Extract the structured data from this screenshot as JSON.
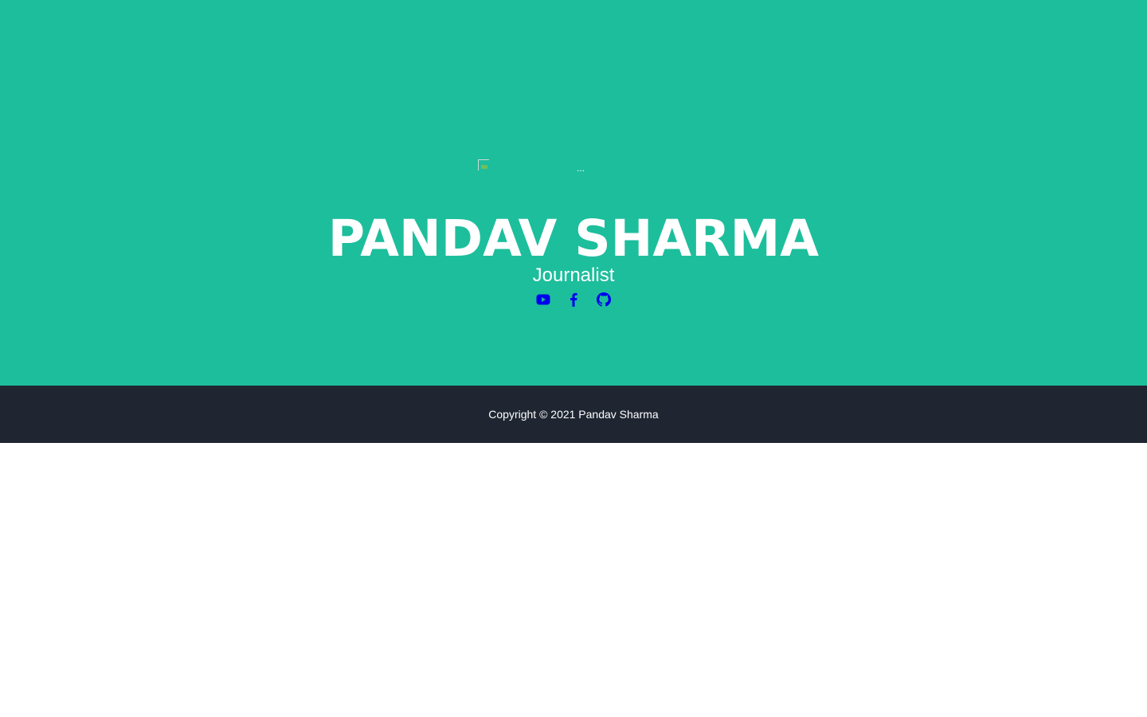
{
  "header": {
    "avatar_alt": "...",
    "name": "PANDAV SHARMA",
    "title": "Journalist"
  },
  "social": [
    {
      "icon": "youtube-icon",
      "color": "#0000ee"
    },
    {
      "icon": "facebook-icon",
      "color": "#0000ee"
    },
    {
      "icon": "github-icon",
      "color": "#0000ee"
    }
  ],
  "footer": {
    "copyright": "Copyright © 2021 Pandav Sharma"
  },
  "colors": {
    "masthead": "#1dbe9c",
    "footer": "#1f2632",
    "text": "#ffffff",
    "link": "#0000ee"
  }
}
